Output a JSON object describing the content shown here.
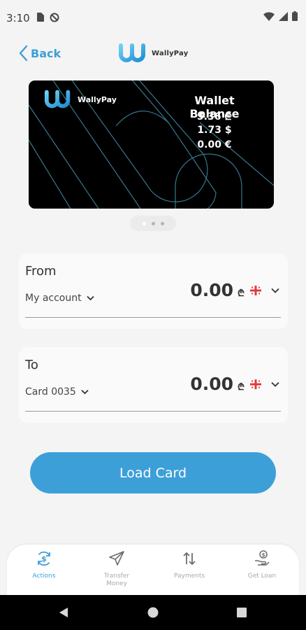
{
  "status_bar": {
    "time": "3:10"
  },
  "header": {
    "back_label": "Back",
    "brand": "WallyPay"
  },
  "card": {
    "brand": "WallyPay",
    "title": "Wallet Balance",
    "balances": [
      "5.36 ₾",
      "1.73 $",
      "0.00 €"
    ]
  },
  "pager": {
    "count": 3,
    "active": 0
  },
  "from": {
    "label": "From",
    "account": "My account",
    "amount": "0.00",
    "currency_symbol": "₾",
    "currency_flag": "georgia-flag-icon"
  },
  "to": {
    "label": "To",
    "account": "Card 0035",
    "amount": "0.00",
    "currency_symbol": "₾",
    "currency_flag": "georgia-flag-icon"
  },
  "load_button": "Load Card",
  "nav": {
    "items": [
      {
        "label": "Actions",
        "icon": "dollar-refresh-icon",
        "active": true
      },
      {
        "label": "Transfer\nMoney",
        "icon": "paper-plane-icon",
        "active": false
      },
      {
        "label": "Payments",
        "icon": "up-down-arrows-icon",
        "active": false
      },
      {
        "label": "Get Loan",
        "icon": "hand-coin-icon",
        "active": false
      }
    ]
  },
  "colors": {
    "accent": "#3d9fd8",
    "card_bg": "#000000",
    "page_bg": "#f4f4f4"
  }
}
